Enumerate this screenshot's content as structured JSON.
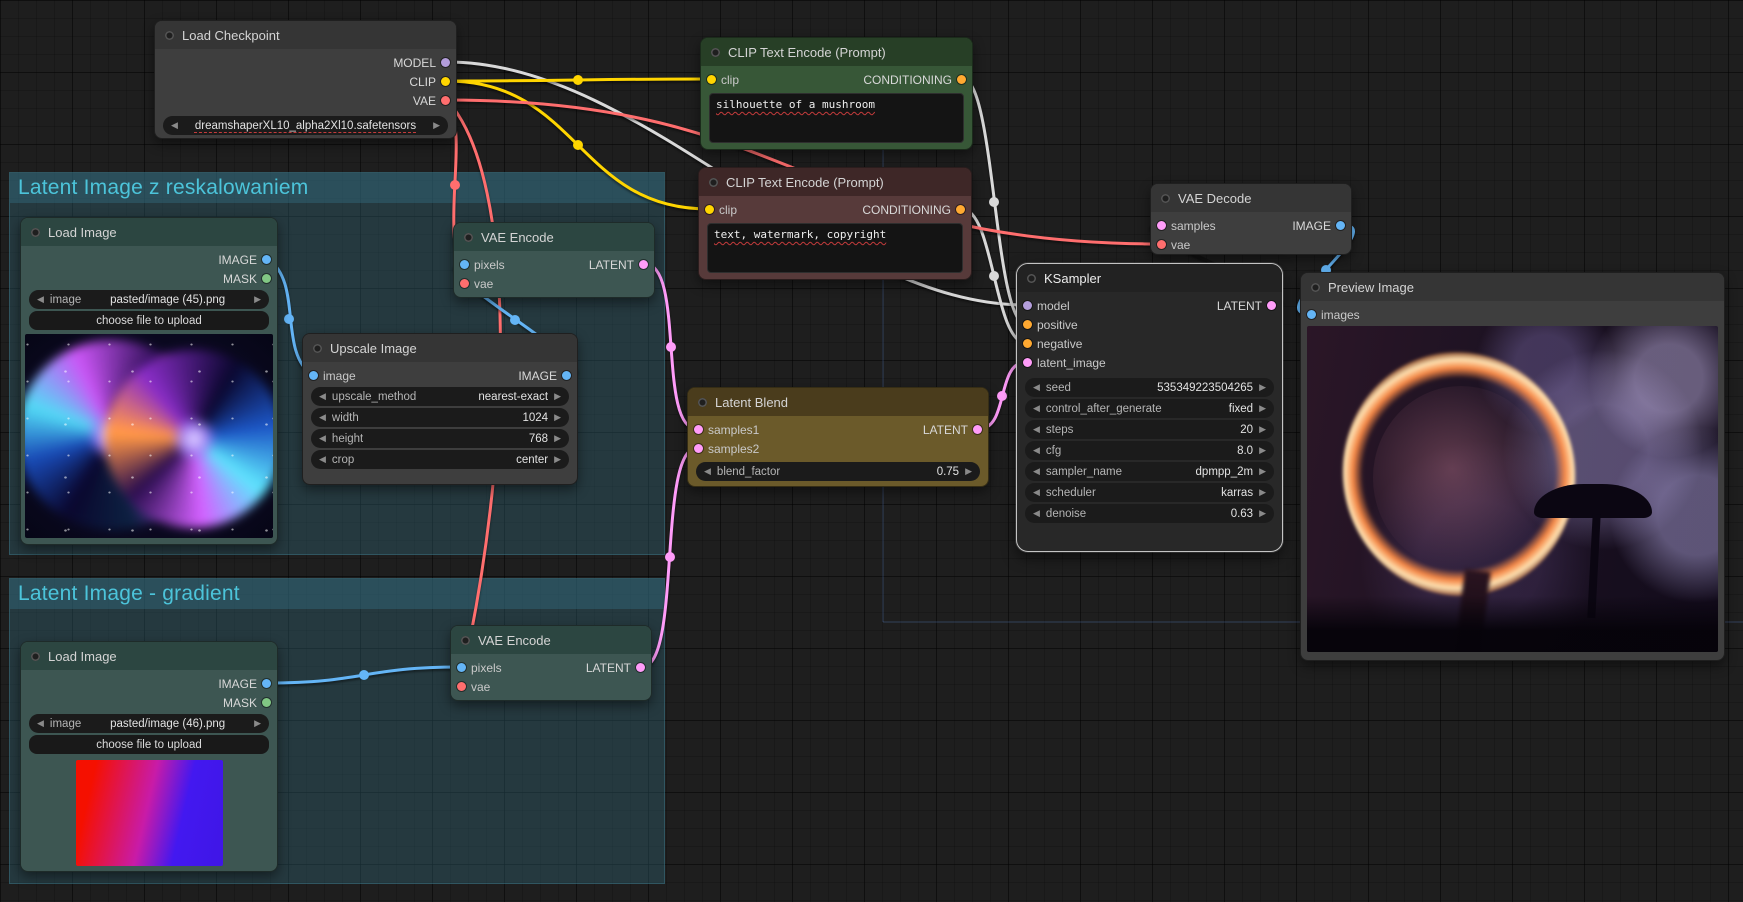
{
  "app": {
    "title": "ComfyUI workflow canvas"
  },
  "icons": {
    "arrow_left": "◀",
    "arrow_right": "▶"
  },
  "colors": {
    "model": "#b39ddb",
    "clip": "#ffd500",
    "vae": "#ff6e6e",
    "conditioning": "#ffa931",
    "image": "#64b5f6",
    "mask": "#81c784",
    "latent": "#ff9cf9",
    "wire_neutral": "#d9d9d9",
    "wire_dark": "#141414",
    "group_fill": "#346e82",
    "group_title": "#4cc4da",
    "spell_underline": "#c43b3b"
  },
  "groups": [
    {
      "title": "Latent Image z reskalowaniem"
    },
    {
      "title": "Latent Image - gradient"
    }
  ],
  "nodes": {
    "load_checkpoint": {
      "title": "Load Checkpoint",
      "outputs": [
        {
          "label": "MODEL"
        },
        {
          "label": "CLIP"
        },
        {
          "label": "VAE"
        }
      ],
      "ckpt_name": "dreamshaperXL10_alpha2Xl10.safetensors"
    },
    "clip_positive": {
      "title": "CLIP Text Encode (Prompt)",
      "inputs": [
        {
          "label": "clip"
        }
      ],
      "outputs": [
        {
          "label": "CONDITIONING"
        }
      ],
      "text": "silhouette of a mushroom"
    },
    "clip_negative": {
      "title": "CLIP Text Encode (Prompt)",
      "inputs": [
        {
          "label": "clip"
        }
      ],
      "outputs": [
        {
          "label": "CONDITIONING"
        }
      ],
      "text": "text, watermark, copyright"
    },
    "vae_decode": {
      "title": "VAE Decode",
      "inputs": [
        {
          "label": "samples"
        },
        {
          "label": "vae"
        }
      ],
      "outputs": [
        {
          "label": "IMAGE"
        }
      ]
    },
    "ksampler": {
      "title": "KSampler",
      "inputs": [
        {
          "label": "model"
        },
        {
          "label": "positive"
        },
        {
          "label": "negative"
        },
        {
          "label": "latent_image"
        }
      ],
      "outputs": [
        {
          "label": "LATENT"
        }
      ],
      "widgets": [
        {
          "label": "seed",
          "value": "535349223504265"
        },
        {
          "label": "control_after_generate",
          "value": "fixed"
        },
        {
          "label": "steps",
          "value": "20"
        },
        {
          "label": "cfg",
          "value": "8.0"
        },
        {
          "label": "sampler_name",
          "value": "dpmpp_2m"
        },
        {
          "label": "scheduler",
          "value": "karras"
        },
        {
          "label": "denoise",
          "value": "0.63"
        }
      ]
    },
    "preview_image": {
      "title": "Preview Image",
      "inputs": [
        {
          "label": "images"
        }
      ]
    },
    "load_image_1": {
      "title": "Load Image",
      "outputs": [
        {
          "label": "IMAGE"
        },
        {
          "label": "MASK"
        }
      ],
      "widgets": [
        {
          "label": "image",
          "value": "pasted/image (45).png"
        }
      ],
      "button": "choose file to upload"
    },
    "vae_encode_1": {
      "title": "VAE Encode",
      "inputs": [
        {
          "label": "pixels"
        },
        {
          "label": "vae"
        }
      ],
      "outputs": [
        {
          "label": "LATENT"
        }
      ]
    },
    "upscale_image": {
      "title": "Upscale Image",
      "inputs": [
        {
          "label": "image"
        }
      ],
      "outputs": [
        {
          "label": "IMAGE"
        }
      ],
      "widgets": [
        {
          "label": "upscale_method",
          "value": "nearest-exact"
        },
        {
          "label": "width",
          "value": "1024"
        },
        {
          "label": "height",
          "value": "768"
        },
        {
          "label": "crop",
          "value": "center"
        }
      ]
    },
    "latent_blend": {
      "title": "Latent Blend",
      "inputs": [
        {
          "label": "samples1"
        },
        {
          "label": "samples2"
        }
      ],
      "outputs": [
        {
          "label": "LATENT"
        }
      ],
      "widgets": [
        {
          "label": "blend_factor",
          "value": "0.75"
        }
      ]
    },
    "load_image_2": {
      "title": "Load Image",
      "outputs": [
        {
          "label": "IMAGE"
        },
        {
          "label": "MASK"
        }
      ],
      "widgets": [
        {
          "label": "image",
          "value": "pasted/image (46).png"
        }
      ],
      "button": "choose file to upload"
    },
    "vae_encode_2": {
      "title": "VAE Encode",
      "inputs": [
        {
          "label": "pixels"
        },
        {
          "label": "vae"
        }
      ],
      "outputs": [
        {
          "label": "LATENT"
        }
      ]
    }
  }
}
